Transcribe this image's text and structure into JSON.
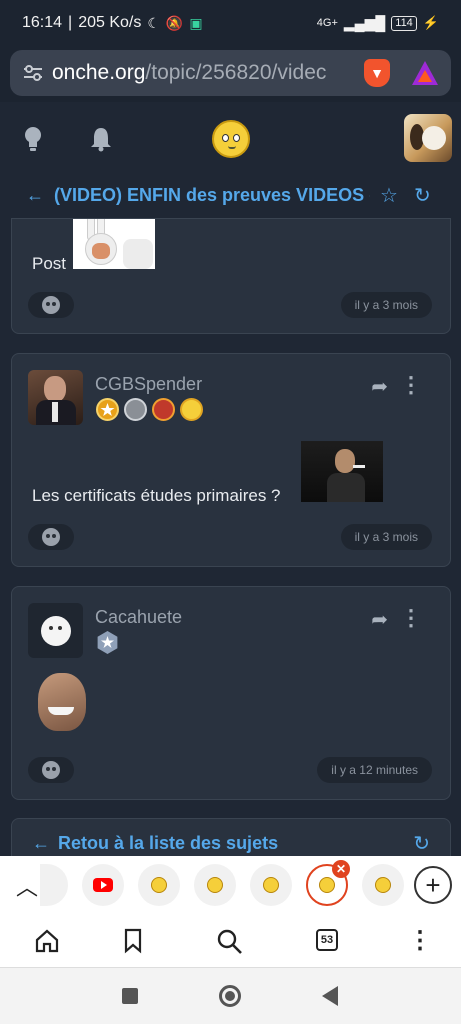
{
  "statusbar": {
    "time": "16:14",
    "speed": "205 Ko/s",
    "network": "4G+",
    "battery": "114"
  },
  "browser": {
    "url_domain": "onche.org",
    "url_path": "/topic/256820/videc"
  },
  "topic": {
    "title": "(VIDEO) ENFIN des preuves VIDEOS de"
  },
  "posts": [
    {
      "text": "Post",
      "time": "il y a 3 mois"
    },
    {
      "username": "CGBSpender",
      "text": "Les certificats études primaires ?",
      "time": "il y a 3 mois"
    },
    {
      "username": "Cacahuete",
      "time": "il y a 12 minutes"
    }
  ],
  "back_link": {
    "label": "Retou à la liste des sujets"
  },
  "tabs": {
    "count": "53"
  },
  "icons": [
    "bulb-icon",
    "bell-icon",
    "star-icon",
    "refresh-icon",
    "share-icon",
    "more-icon",
    "home-icon",
    "bookmark-icon",
    "search-icon"
  ],
  "colors": {
    "accent": "#55a8ea",
    "card": "#29323f",
    "background": "#1f2734",
    "close_badge": "#e0431f"
  }
}
